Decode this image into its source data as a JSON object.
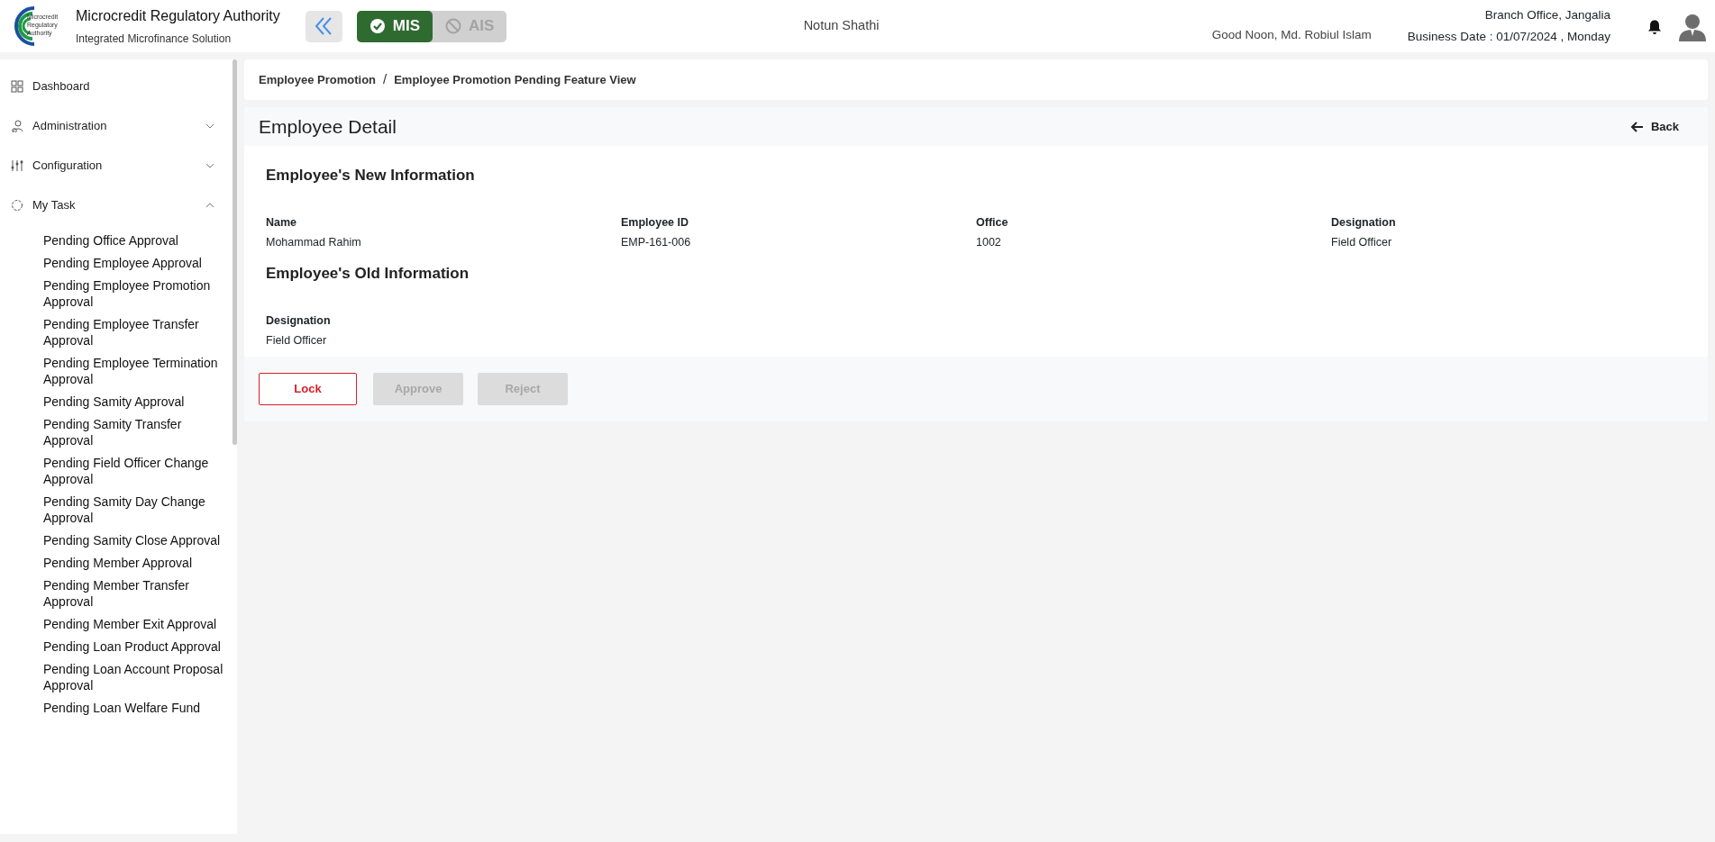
{
  "header": {
    "org_name": "Microcredit Regulatory Authority",
    "org_subtitle": "Integrated Microfinance Solution",
    "logo_text": "Microcredit Regulatory Authority",
    "modules": [
      {
        "label": "MIS",
        "selected": true
      },
      {
        "label": "AIS",
        "selected": false
      }
    ],
    "project": "Notun Shathi",
    "greeting": "Good Noon, Md. Robiul Islam",
    "branch": "Branch Office, Jangalia",
    "business_date": "Business Date : 01/07/2024 , Monday"
  },
  "sidebar": {
    "items": [
      {
        "label": "Dashboard"
      },
      {
        "label": "Administration",
        "expanded": false
      },
      {
        "label": "Configuration",
        "expanded": false
      },
      {
        "label": "My Task",
        "expanded": true,
        "children": [
          "Pending Office Approval",
          "Pending Employee Approval",
          "Pending Employee Promotion Approval",
          "Pending Employee Transfer Approval",
          "Pending Employee Termination Approval",
          "Pending Samity Approval",
          "Pending Samity Transfer Approval",
          "Pending Field Officer Change Approval",
          "Pending Samity Day Change Approval",
          "Pending Samity Close Approval",
          "Pending Member Approval",
          "Pending Member Transfer Approval",
          "Pending Member Exit Approval",
          "Pending Loan Product Approval",
          "Pending Loan Account Proposal Approval",
          "Pending Loan Welfare Fund"
        ]
      }
    ]
  },
  "breadcrumb": [
    "Employee Promotion",
    "Employee Promotion Pending Feature View"
  ],
  "breadcrumb_separator": "/",
  "detail": {
    "title": "Employee Detail",
    "back": "Back",
    "sections": [
      {
        "heading": "Employee's New Information",
        "fields": [
          {
            "label": "Name",
            "value": "Mohammad Rahim"
          },
          {
            "label": "Employee ID",
            "value": "EMP-161-006"
          },
          {
            "label": "Office",
            "value": "1002"
          },
          {
            "label": "Designation",
            "value": "Field Officer"
          }
        ]
      },
      {
        "heading": "Employee's Old Information",
        "fields": [
          {
            "label": "Designation",
            "value": "Field Officer"
          }
        ]
      }
    ],
    "buttons": [
      {
        "label": "Lock",
        "disabled": false
      },
      {
        "label": "Approve",
        "disabled": true
      },
      {
        "label": "Reject",
        "disabled": true
      }
    ]
  }
}
